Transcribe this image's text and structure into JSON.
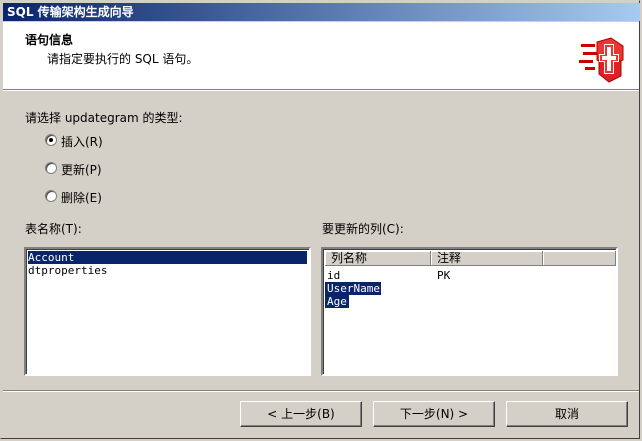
{
  "window": {
    "title": "SQL 传输架构生成向导"
  },
  "header": {
    "title": "语句信息",
    "subtitle": "请指定要执行的 SQL 语句。"
  },
  "type_prompt": "请选择 updategram 的类型:",
  "radios": [
    {
      "label": "插入(R)",
      "checked": true
    },
    {
      "label": "更新(P)",
      "checked": false
    },
    {
      "label": "删除(E)",
      "checked": false
    }
  ],
  "table_list": {
    "label": "表名称(T):",
    "items": [
      "Account",
      "dtproperties"
    ],
    "selected": "Account"
  },
  "columns_list": {
    "label": "要更新的列(C):",
    "headers": [
      "列名称",
      "注释"
    ],
    "rows": [
      {
        "name": "id",
        "note": "PK",
        "selected": false
      },
      {
        "name": "UserName",
        "note": "",
        "selected": true
      },
      {
        "name": "Age",
        "note": "",
        "selected": true
      }
    ]
  },
  "buttons": {
    "back": "< 上一步(B)",
    "next": "下一步(N) >",
    "cancel": "取消"
  }
}
